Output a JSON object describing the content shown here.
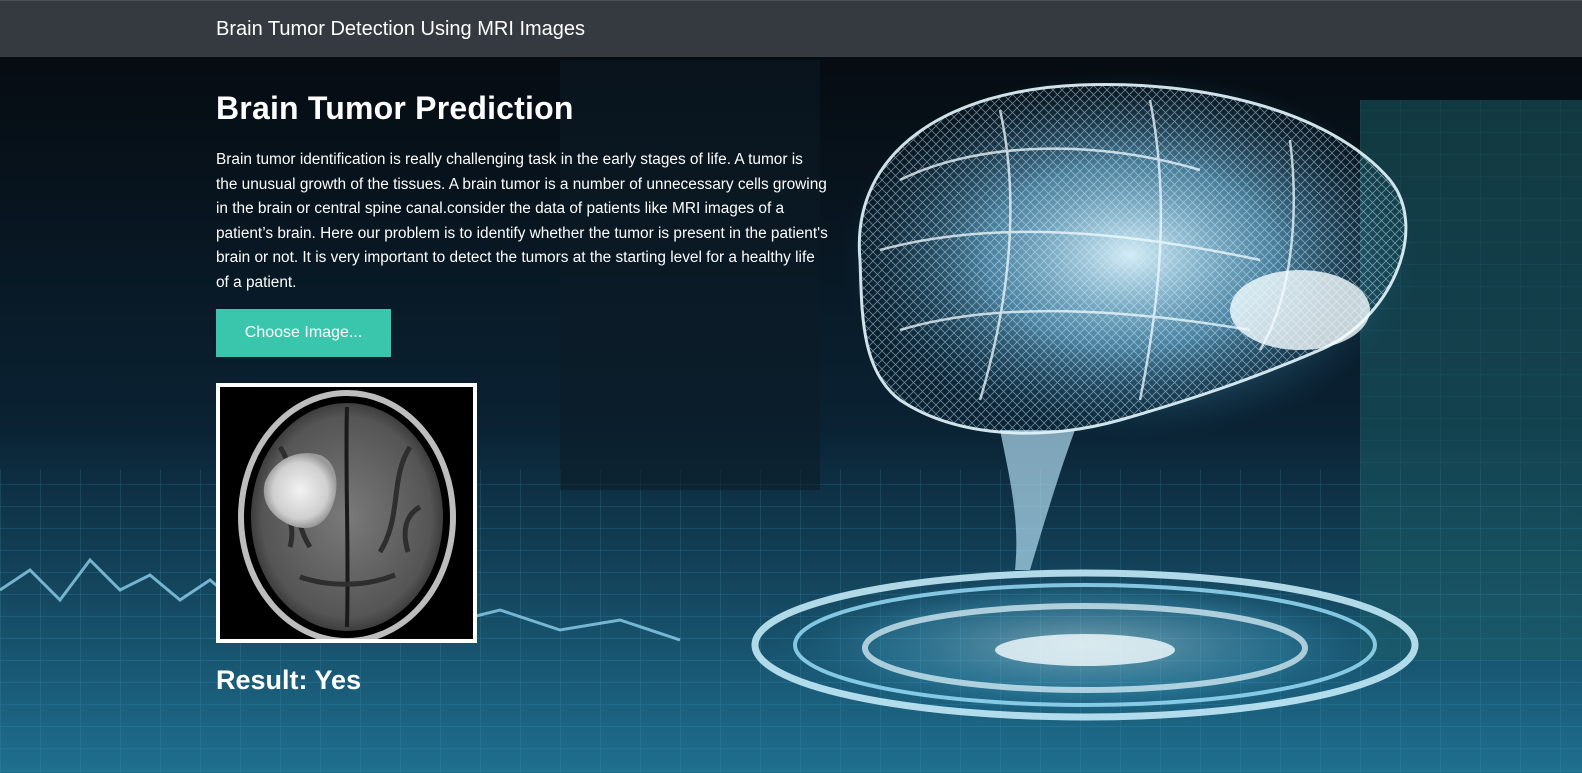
{
  "navbar": {
    "brand": "Brain Tumor Detection Using MRI Images"
  },
  "main": {
    "title": "Brain Tumor Prediction",
    "description": "Brain tumor identification is really challenging task in the early stages of life. A tumor is the unusual growth of the tissues. A brain tumor is a number of unnecessary cells growing in the brain or central spine canal.consider the data of patients like MRI images of a patient’s brain. Here our problem is to identify whether the tumor is present in the patient's brain or not. It is very important to detect the tumors at the starting level for a healthy life of a patient.",
    "choose_button": "Choose Image...",
    "result_label": "Result:",
    "result_value": "Yes"
  },
  "colors": {
    "navbar": "#343a40",
    "button": "#39c6ad",
    "text": "#ffffff",
    "hologram": "#7fd4ff"
  }
}
